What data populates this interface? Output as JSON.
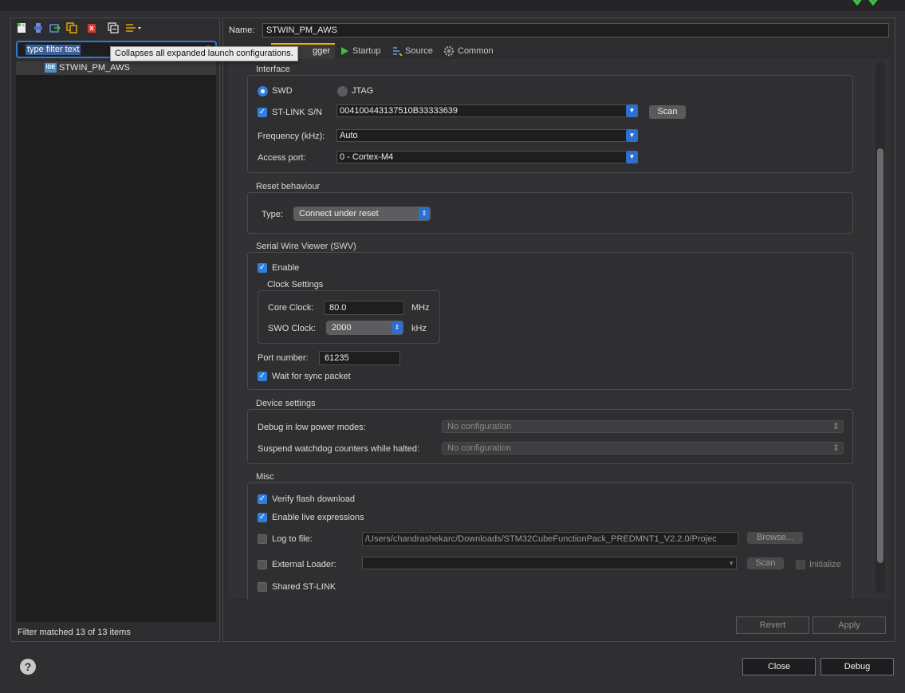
{
  "left": {
    "filter_placeholder": "type filter text",
    "tooltip": "Collapses all expanded launch configurations.",
    "tree_items": [
      {
        "label": "STWIN_PM_AWS",
        "badge": "IDE"
      }
    ],
    "filter_status": "Filter matched 13 of 13 items"
  },
  "right": {
    "name_label": "Name:",
    "name_value": "STWIN_PM_AWS",
    "tabs": {
      "debugger": "gger",
      "startup": "Startup",
      "source": "Source",
      "common": "Common"
    }
  },
  "interface": {
    "title": "Interface",
    "swd": "SWD",
    "jtag": "JTAG",
    "stlink_label": "ST-LINK S/N",
    "stlink_value": "004100443137510B33333639",
    "scan": "Scan",
    "freq_label": "Frequency (kHz):",
    "freq_value": "Auto",
    "access_label": "Access port:",
    "access_value": "0 - Cortex-M4"
  },
  "reset": {
    "title": "Reset behaviour",
    "type_label": "Type:",
    "type_value": "Connect under reset"
  },
  "swv": {
    "title": "Serial Wire Viewer (SWV)",
    "enable": "Enable",
    "clock_title": "Clock Settings",
    "core_label": "Core Clock:",
    "core_value": "80.0",
    "core_unit": "MHz",
    "swo_label": "SWO Clock:",
    "swo_value": "2000",
    "swo_unit": "kHz",
    "port_label": "Port number:",
    "port_value": "61235",
    "wait_sync": "Wait for sync packet"
  },
  "device": {
    "title": "Device settings",
    "lowpower_label": "Debug in low power modes:",
    "lowpower_value": "No configuration",
    "watchdog_label": "Suspend watchdog counters while halted:",
    "watchdog_value": "No configuration"
  },
  "misc": {
    "title": "Misc",
    "verify": "Verify flash download",
    "live": "Enable live expressions",
    "log_label": "Log to file:",
    "log_path": "/Users/chandrashekarc/Downloads/STM32CubeFunctionPack_PREDMNT1_V2.2.0/Projec",
    "browse": "Browse...",
    "ext_label": "External Loader:",
    "scan": "Scan",
    "initialize": "Initialize",
    "shared": "Shared ST-LINK"
  },
  "buttons": {
    "revert": "Revert",
    "apply": "Apply",
    "close": "Close",
    "debug": "Debug"
  },
  "colors": {
    "accent": "#2f7fe0",
    "tab_highlight": "#e0b400"
  }
}
